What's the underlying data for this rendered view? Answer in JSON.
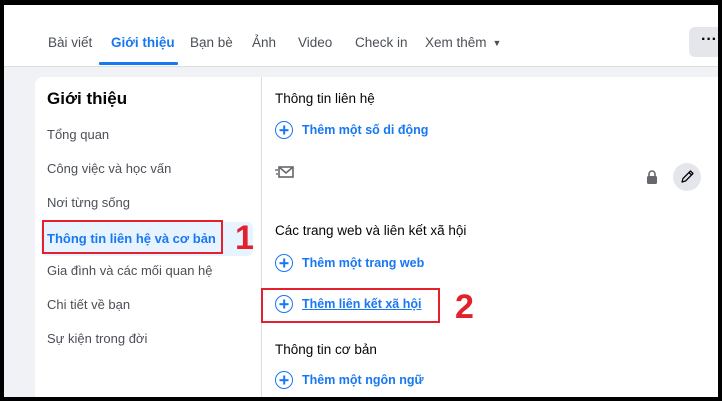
{
  "tabs": [
    {
      "label": "Bài viết"
    },
    {
      "label": "Giới thiệu"
    },
    {
      "label": "Bạn bè"
    },
    {
      "label": "Ảnh"
    },
    {
      "label": "Video"
    },
    {
      "label": "Check in"
    },
    {
      "label": "Xem thêm"
    }
  ],
  "tabs_active": "Giới thiệu",
  "more_button": {
    "label": "···"
  },
  "sidebar": {
    "title": "Giới thiệu",
    "items": [
      {
        "label": "Tổng quan"
      },
      {
        "label": "Công việc và học vấn"
      },
      {
        "label": "Nơi từng sống"
      },
      {
        "label": "Thông tin liên hệ và cơ bản"
      },
      {
        "label": "Gia đình và các mối quan hệ"
      },
      {
        "label": "Chi tiết về bạn"
      },
      {
        "label": "Sự kiện trong đời"
      }
    ],
    "active": "Thông tin liên hệ và cơ bản"
  },
  "content": {
    "contact_title": "Thông tin liên hệ",
    "add_phone": "Thêm một số di động",
    "websites_title": "Các trang web và liên kết xã hội",
    "add_website": "Thêm một trang web",
    "add_social": "Thêm liên kết xã hội",
    "basic_title": "Thông tin cơ bản",
    "add_language": "Thêm một ngôn ngữ"
  },
  "annotations": [
    {
      "number": "1"
    },
    {
      "number": "2"
    }
  ],
  "colors": {
    "accent": "#1877f2",
    "annotation": "#e3202b"
  }
}
